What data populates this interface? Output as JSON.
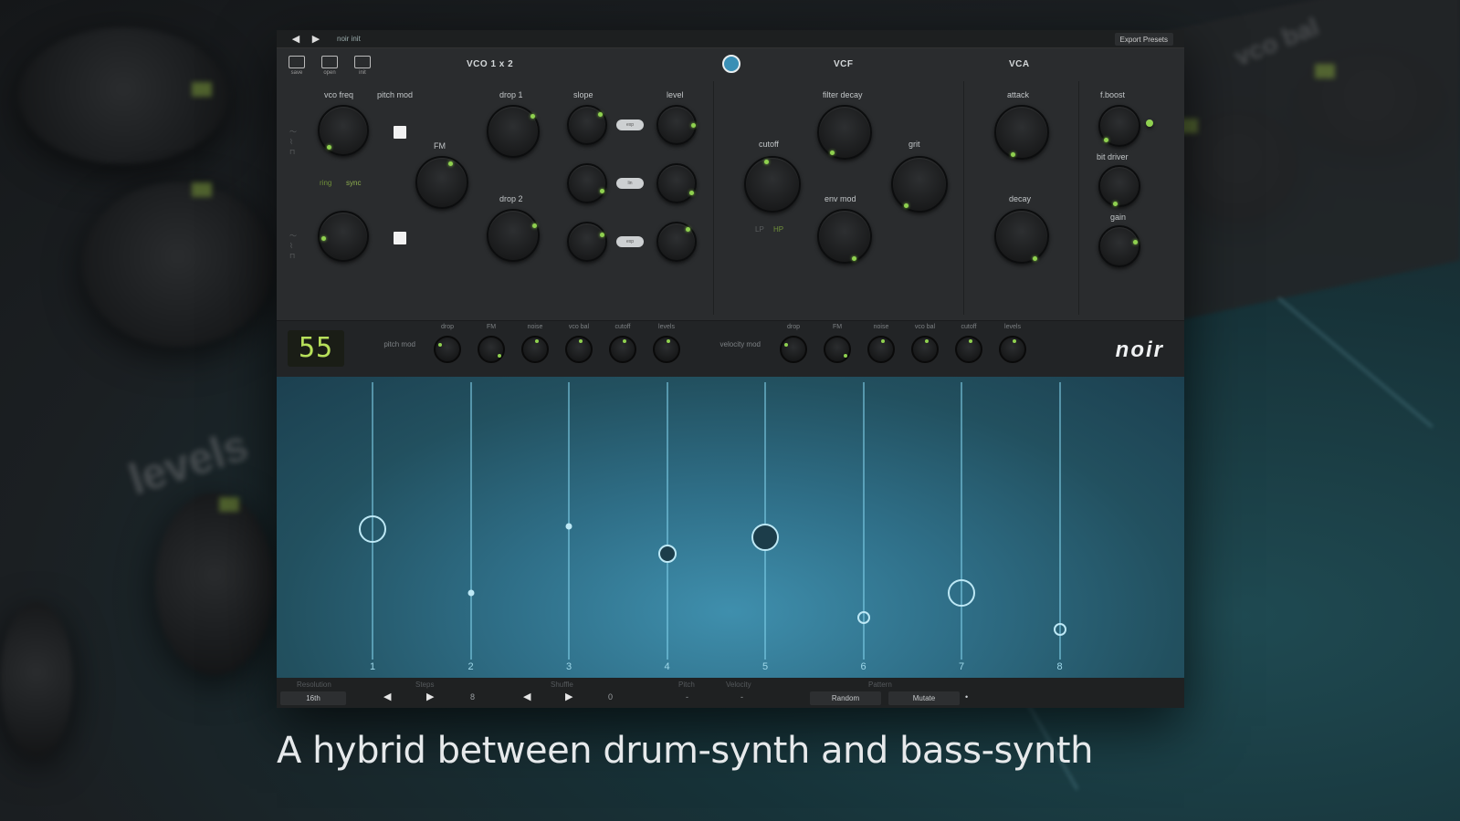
{
  "titlebar": {
    "prev_icon": "triangle-left",
    "next_icon": "triangle-right",
    "preset_name": "noir init",
    "export_label": "Export Presets"
  },
  "sections": {
    "vco": "VCO 1 x 2",
    "vcf": "VCF",
    "vca": "VCA"
  },
  "file_buttons": [
    "save",
    "open",
    "init"
  ],
  "vco": {
    "vco_freq": "vco freq",
    "pitch_mod": "pitch mod",
    "fm": "FM",
    "ring": "ring",
    "sync": "sync"
  },
  "drops": {
    "drop1": "drop 1",
    "drop2": "drop 2",
    "slope": "slope",
    "level": "level"
  },
  "vcf": {
    "filter_decay": "filter decay",
    "cutoff": "cutoff",
    "grit": "grit",
    "env_mod": "env mod",
    "lp": "LP",
    "hp": "HP"
  },
  "vca": {
    "attack": "attack",
    "decay": "decay"
  },
  "output": {
    "filter_label": "f.boost",
    "bit_label": "bit driver",
    "gain_label": "gain"
  },
  "mod": {
    "lcd_value": "55",
    "pitch_mod_label": "pitch mod",
    "velocity_mod_label": "velocity mod",
    "left_knobs": [
      "drop",
      "FM",
      "noise",
      "vco bal",
      "cutoff",
      "levels"
    ],
    "right_knobs": [
      "drop",
      "FM",
      "noise",
      "vco bal",
      "cutoff",
      "levels"
    ],
    "brand": "noir"
  },
  "sequencer": {
    "steps": [
      "1",
      "2",
      "3",
      "4",
      "5",
      "6",
      "7",
      "8"
    ],
    "step_values": [
      0.47,
      0.24,
      0.48,
      0.38,
      0.44,
      0.15,
      0.24,
      0.11
    ],
    "step_velocities": [
      "large",
      "tiny",
      "tiny",
      "medium",
      "large",
      "small",
      "large",
      "small"
    ]
  },
  "controls": {
    "resolution_label": "Resolution",
    "resolution_value": "16th",
    "steps_label": "Steps",
    "steps_value": "8",
    "shuffle_label": "Shuffle",
    "shuffle_value": "0",
    "pitch_label": "Pitch",
    "pitch_value": "-",
    "velocity_label": "Velocity",
    "velocity_value": "-",
    "pattern_label": "Pattern",
    "random_label": "Random",
    "mutate_label": "Mutate"
  },
  "caption": "A hybrid between drum-synth and bass-synth",
  "colors": {
    "accent_green": "#8fd14f",
    "sequencer_blue": "#3f8fad",
    "panel": "#2a2c2e"
  }
}
